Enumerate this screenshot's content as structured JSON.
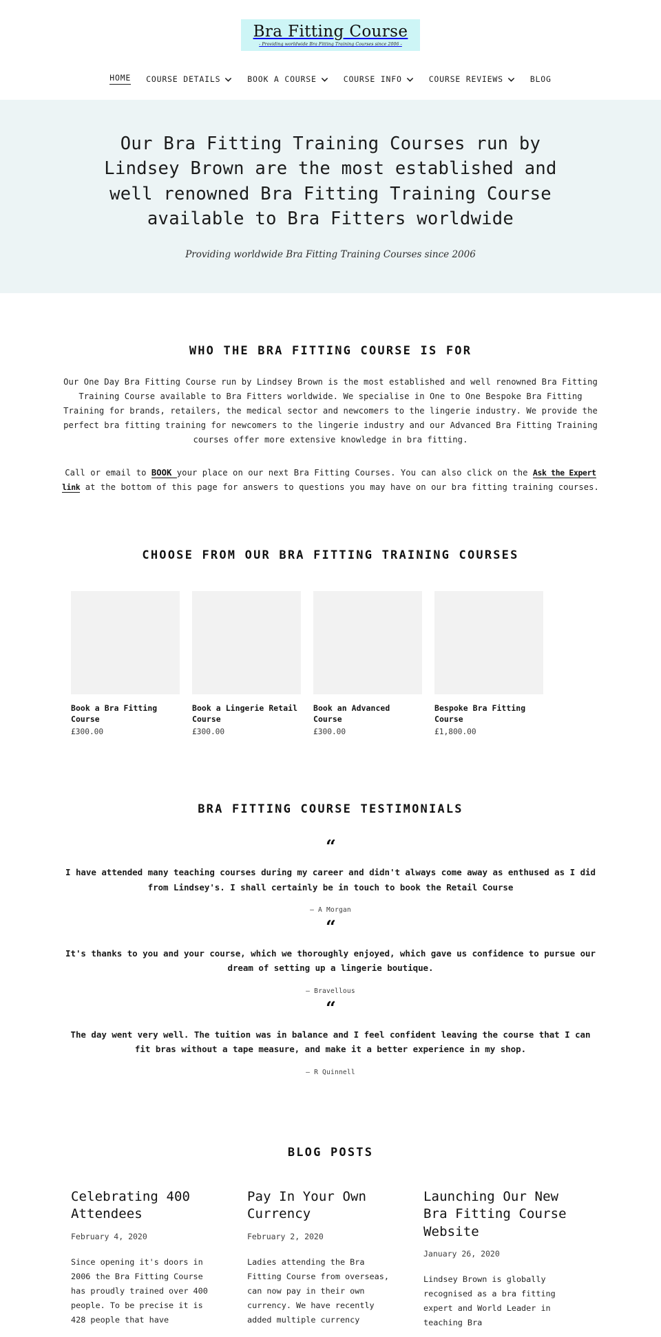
{
  "header": {
    "logo_title": "Bra Fitting Course",
    "logo_tagline": "- Providing worldwide Bra Fitting Training Courses since 2006 -",
    "logo_bg": "#cdf5f6"
  },
  "nav": {
    "items": [
      {
        "label": "HOME",
        "has_dropdown": false,
        "active": true
      },
      {
        "label": "COURSE DETAILS",
        "has_dropdown": true,
        "active": false
      },
      {
        "label": "BOOK A COURSE",
        "has_dropdown": true,
        "active": false
      },
      {
        "label": "COURSE INFO",
        "has_dropdown": true,
        "active": false
      },
      {
        "label": "COURSE REVIEWS",
        "has_dropdown": true,
        "active": false
      },
      {
        "label": "BLOG",
        "has_dropdown": false,
        "active": false
      }
    ]
  },
  "hero": {
    "heading": "Our Bra Fitting Training Courses run by Lindsey Brown are the most established and well renowned Bra Fitting Training Course available to Bra Fitters worldwide",
    "subtitle": "Providing worldwide Bra Fitting Training Courses since 2006",
    "bg": "#ecf4f5"
  },
  "intro": {
    "title": "WHO THE BRA FITTING COURSE IS FOR",
    "paragraph1": "Our One Day Bra Fitting Course run by Lindsey Brown is the most established and well renowned Bra Fitting Training Course available to Bra Fitters worldwide. We specialise in One to One Bespoke Bra Fitting Training for brands, retailers, the medical sector and newcomers to the lingerie industry. We provide the perfect bra fitting training for newcomers to the lingerie industry and our Advanced Bra Fitting Training courses offer more extensive knowledge in bra fitting.",
    "paragraph2_part1": "Call or email to ",
    "link_book": "BOOK ",
    "paragraph2_part2": " your place on our next Bra Fitting Courses. You can also click on the ",
    "link_ask": "Ask the Expert link",
    "paragraph2_part3": " at the bottom of this page for answers to questions you may have on our bra fitting training courses."
  },
  "products": {
    "title": "CHOOSE FROM OUR BRA FITTING TRAINING COURSES",
    "items": [
      {
        "name": "Book a Bra Fitting Course",
        "price": "£300.00"
      },
      {
        "name": "Book a Lingerie Retail Course",
        "price": "£300.00"
      },
      {
        "name": "Book an Advanced Course",
        "price": "£300.00"
      },
      {
        "name": "Bespoke Bra Fitting Course",
        "price": "£1,800.00"
      }
    ]
  },
  "testimonials": {
    "title": "BRA FITTING COURSE TESTIMONIALS",
    "quote_glyph": "“",
    "items": [
      {
        "text": "I have attended many teaching courses during my career and didn't always come away as enthused as I did from Lindsey's. I shall certainly be in touch to book the Retail Course",
        "author": "— A Morgan"
      },
      {
        "text": "It's thanks to you and your course, which we thoroughly enjoyed, which gave us confidence to pursue our dream of setting up a lingerie boutique.",
        "author": "— Bravellous"
      },
      {
        "text": "The day went very well. The tuition was in balance and I feel confident leaving the course that I can fit bras without a tape measure, and make it a better experience in my shop.",
        "author": "— R Quinnell"
      }
    ]
  },
  "blog": {
    "title": "BLOG POSTS",
    "posts": [
      {
        "title": "Celebrating 400 Attendees",
        "date": "February 4, 2020",
        "excerpt": "Since opening it's doors in 2006 the Bra Fitting Course has proudly trained over 400 people. To be precise it is 428 people that have"
      },
      {
        "title": "Pay In Your Own Currency",
        "date": "February 2, 2020",
        "excerpt": "Ladies attending the Bra Fitting Course from overseas, can now pay in their own currency. We have recently added multiple currency"
      },
      {
        "title": "Launching Our New Bra Fitting Course Website",
        "date": "January 26, 2020",
        "excerpt": "Lindsey Brown is globally recognised as a bra fitting expert and World Leader in teaching Bra"
      }
    ]
  }
}
